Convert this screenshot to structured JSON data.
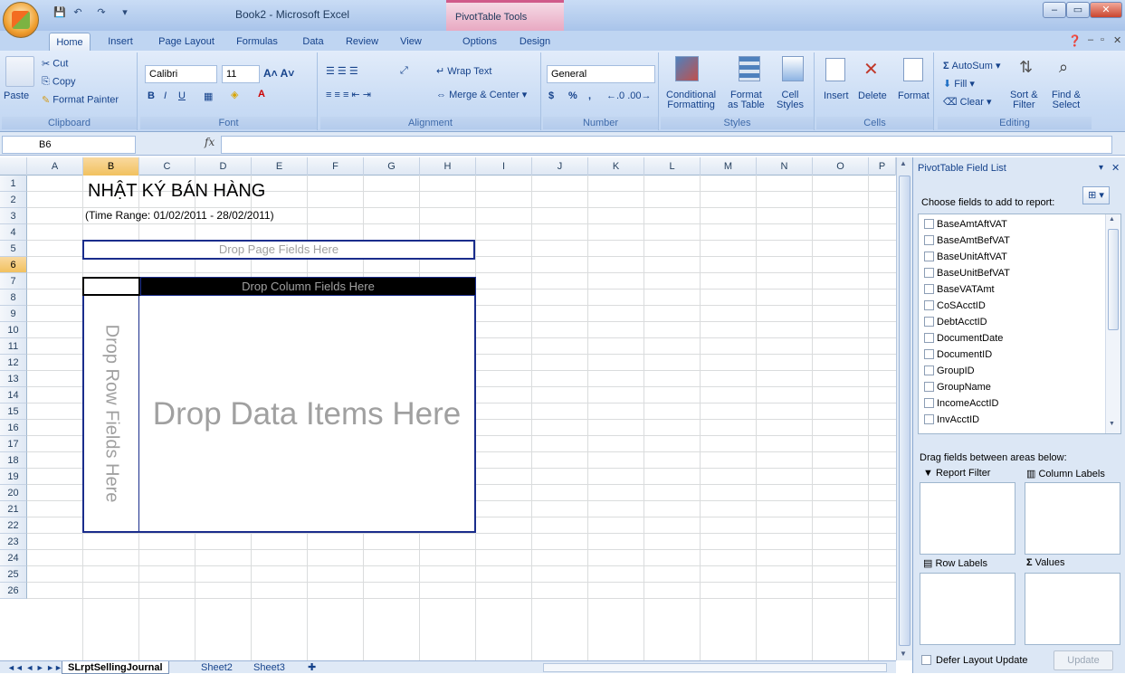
{
  "window": {
    "title": "Book2 - Microsoft Excel",
    "context_tab": "PivotTable Tools"
  },
  "tabs": [
    "Home",
    "Insert",
    "Page Layout",
    "Formulas",
    "Data",
    "Review",
    "View",
    "Options",
    "Design"
  ],
  "ribbon": {
    "clipboard": {
      "label": "Clipboard",
      "paste": "Paste",
      "cut": "Cut",
      "copy": "Copy",
      "format_painter": "Format Painter"
    },
    "font": {
      "label": "Font",
      "name": "Calibri",
      "size": "11"
    },
    "alignment": {
      "label": "Alignment",
      "wrap_text": "Wrap Text",
      "merge_center": "Merge & Center"
    },
    "number": {
      "label": "Number",
      "format": "General",
      "currency": "$",
      "percent": "%",
      "comma": ","
    },
    "styles": {
      "label": "Styles",
      "conditional_1": "Conditional",
      "conditional_2": "Formatting",
      "format_1": "Format",
      "format_2": "as Table",
      "cell_1": "Cell",
      "cell_2": "Styles"
    },
    "cells": {
      "label": "Cells",
      "insert": "Insert",
      "delete": "Delete",
      "format": "Format"
    },
    "editing": {
      "label": "Editing",
      "autosum": "AutoSum",
      "fill": "Fill",
      "clear": "Clear",
      "sort_1": "Sort &",
      "sort_2": "Filter",
      "find_1": "Find &",
      "find_2": "Select"
    }
  },
  "formula_bar": {
    "name_box": "B6",
    "fx": "fx",
    "value": ""
  },
  "columns": [
    "A",
    "B",
    "C",
    "D",
    "E",
    "F",
    "G",
    "H",
    "I",
    "J",
    "K",
    "L",
    "M",
    "N",
    "O",
    "P"
  ],
  "rows": [
    "1",
    "2",
    "3",
    "4",
    "5",
    "6",
    "7",
    "8",
    "9",
    "10",
    "11",
    "12",
    "13",
    "14",
    "15",
    "16",
    "17",
    "18",
    "19",
    "20",
    "21",
    "22",
    "23",
    "24",
    "25",
    "26"
  ],
  "sheet": {
    "title": "NHẬT KÝ BÁN HÀNG",
    "range": "(Time Range: 01/02/2011 - 28/02/2011)",
    "page_drop": "Drop Page Fields Here",
    "column_drop": "Drop Column Fields Here",
    "row_drop": "Drop Row Fields Here",
    "data_drop": "Drop Data Items Here"
  },
  "sheet_tabs": [
    "SLrptSellingJournal",
    "Sheet2",
    "Sheet3"
  ],
  "field_list": {
    "title": "PivotTable Field List",
    "choose": "Choose fields to add to report:",
    "fields": [
      "BaseAmtAftVAT",
      "BaseAmtBefVAT",
      "BaseUnitAftVAT",
      "BaseUnitBefVAT",
      "BaseVATAmt",
      "CoSAcctID",
      "DebtAcctID",
      "DocumentDate",
      "DocumentID",
      "GroupID",
      "GroupName",
      "IncomeAcctID",
      "InvAcctID"
    ],
    "drag_label": "Drag fields between areas below:",
    "report_filter": "Report Filter",
    "column_labels": "Column Labels",
    "row_labels": "Row Labels",
    "values": "Values",
    "defer": "Defer Layout Update",
    "update": "Update"
  }
}
